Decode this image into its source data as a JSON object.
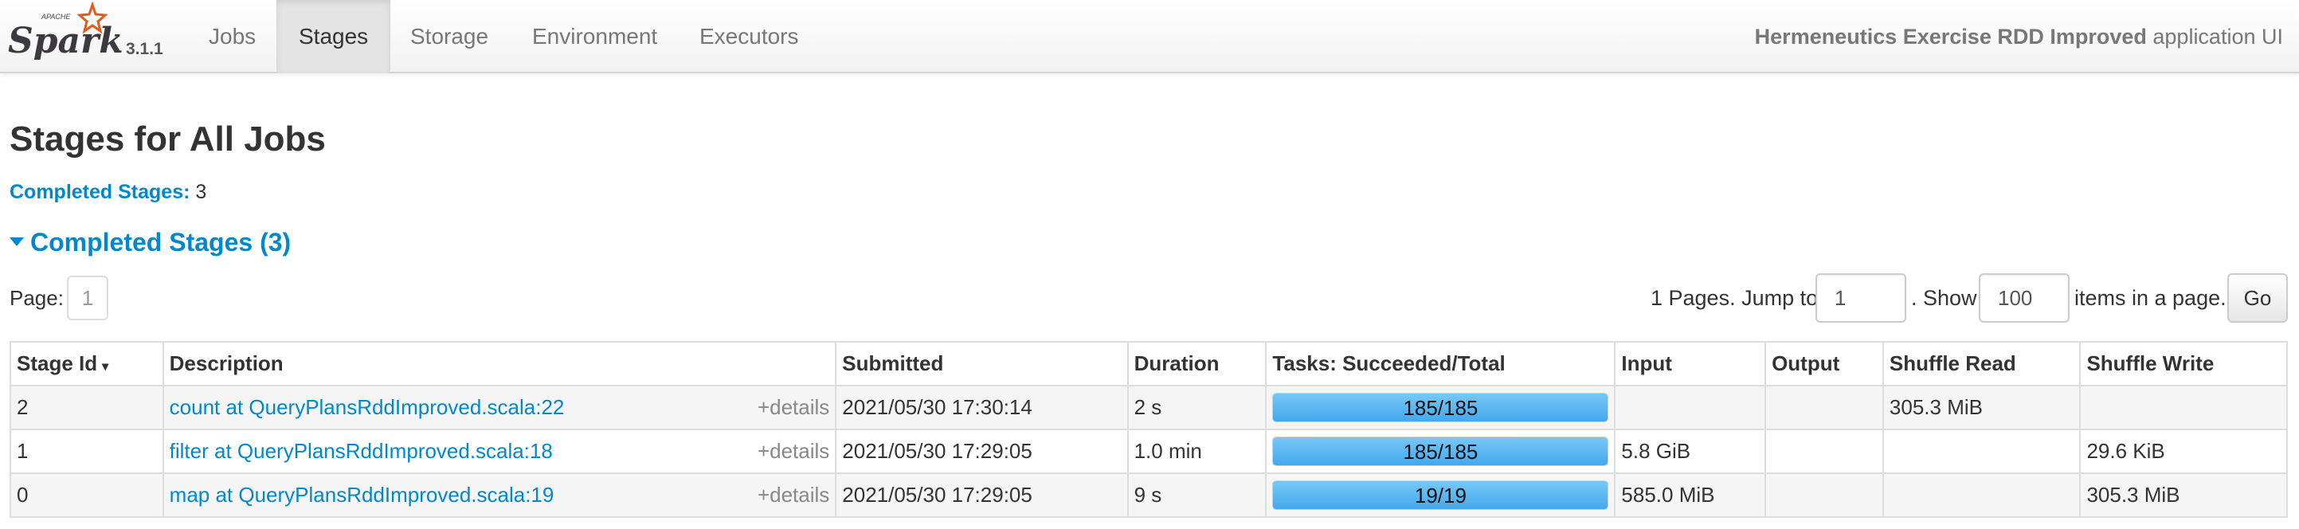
{
  "brand": {
    "logo_top_text": "APACHE",
    "logo_text": "Spark",
    "version": "3.1.1",
    "accent": "#0088cc",
    "logo_star": "#e25a1c"
  },
  "nav": {
    "tabs": [
      {
        "label": "Jobs"
      },
      {
        "label": "Stages",
        "active": true
      },
      {
        "label": "Storage"
      },
      {
        "label": "Environment"
      },
      {
        "label": "Executors"
      }
    ],
    "app_name": "Hermeneutics Exercise RDD Improved",
    "app_suffix": "application UI"
  },
  "page": {
    "title": "Stages for All Jobs",
    "summary_label": "Completed Stages:",
    "summary_value": "3",
    "section_title": "Completed Stages (3)"
  },
  "pager": {
    "page_label": "Page:",
    "page_number": "1",
    "pages_text": "1 Pages. Jump to",
    "jump_value": "1",
    "show_text": ". Show",
    "show_value": "100",
    "items_text": "items in a page.",
    "go_label": "Go"
  },
  "table": {
    "headers": [
      "Stage Id",
      "Description",
      "Submitted",
      "Duration",
      "Tasks: Succeeded/Total",
      "Input",
      "Output",
      "Shuffle Read",
      "Shuffle Write"
    ],
    "sort_indicator": "▾",
    "details_label": "+details",
    "rows": [
      {
        "stage_id": "2",
        "description": "count at QueryPlansRddImproved.scala:22",
        "submitted": "2021/05/30 17:30:14",
        "duration": "2 s",
        "tasks": "185/185",
        "tasks_fraction": 1.0,
        "input": "",
        "output": "",
        "shuffle_read": "305.3 MiB",
        "shuffle_write": ""
      },
      {
        "stage_id": "1",
        "description": "filter at QueryPlansRddImproved.scala:18",
        "submitted": "2021/05/30 17:29:05",
        "duration": "1.0 min",
        "tasks": "185/185",
        "tasks_fraction": 1.0,
        "input": "5.8 GiB",
        "output": "",
        "shuffle_read": "",
        "shuffle_write": "29.6 KiB"
      },
      {
        "stage_id": "0",
        "description": "map at QueryPlansRddImproved.scala:19",
        "submitted": "2021/05/30 17:29:05",
        "duration": "9 s",
        "tasks": "19/19",
        "tasks_fraction": 1.0,
        "input": "585.0 MiB",
        "output": "",
        "shuffle_read": "",
        "shuffle_write": "305.3 MiB"
      }
    ]
  }
}
